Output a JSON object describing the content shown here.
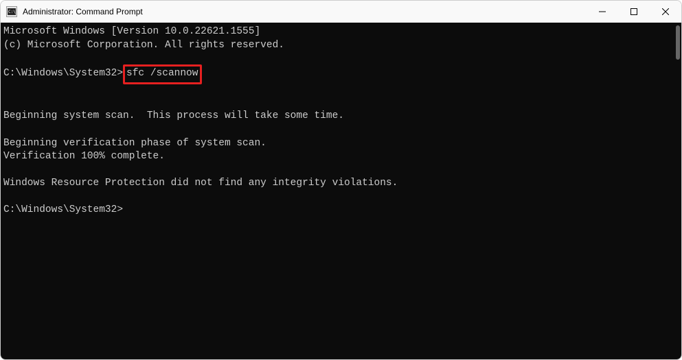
{
  "titlebar": {
    "title": "Administrator: Command Prompt"
  },
  "terminal": {
    "line1": "Microsoft Windows [Version 10.0.22621.1555]",
    "line2": "(c) Microsoft Corporation. All rights reserved.",
    "prompt1_path": "C:\\Windows\\System32>",
    "prompt1_command": "sfc /scannow",
    "line4": "Beginning system scan.  This process will take some time.",
    "line5": "Beginning verification phase of system scan.",
    "line6": "Verification 100% complete.",
    "line7": "Windows Resource Protection did not find any integrity violations.",
    "prompt2_path": "C:\\Windows\\System32>"
  }
}
